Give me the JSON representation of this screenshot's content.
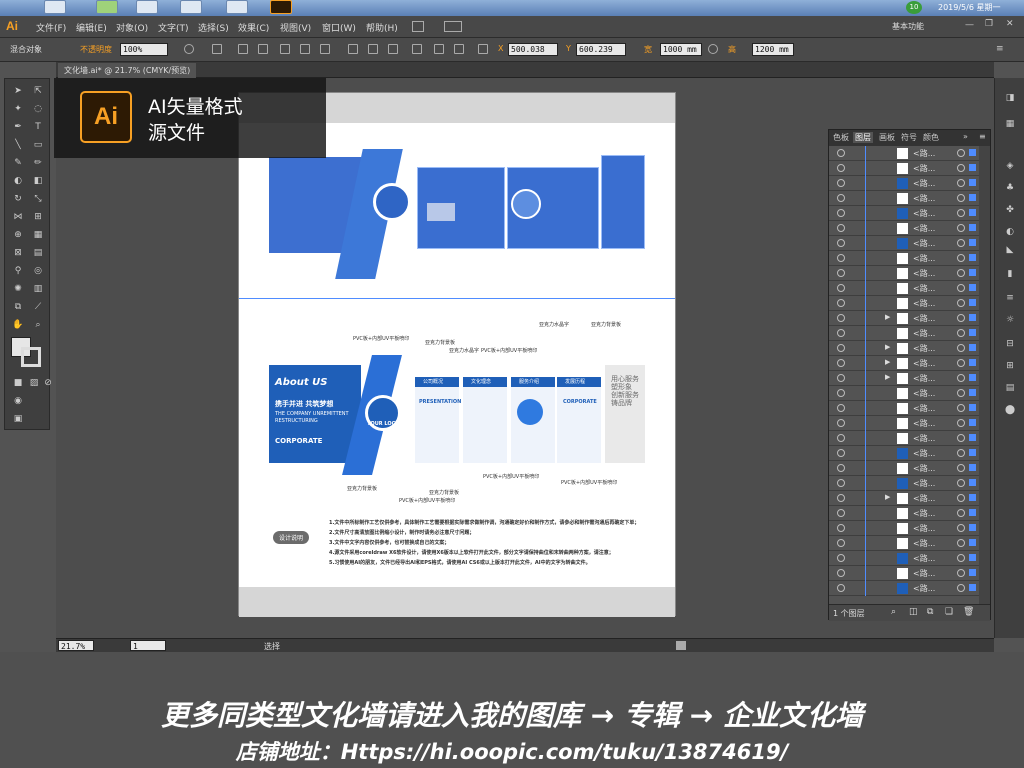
{
  "taskbar": {
    "datetime": "2019/5/6 星期一",
    "badge_count": "10"
  },
  "menubar": {
    "app_logo": "Ai",
    "items": [
      "文件(F)",
      "编辑(E)",
      "对象(O)",
      "文字(T)",
      "选择(S)",
      "效果(C)",
      "视图(V)",
      "窗口(W)",
      "帮助(H)"
    ],
    "workspace": "基本功能"
  },
  "controlbar": {
    "selection": "混合对象",
    "opacity_label": "不透明度",
    "opacity": "100%",
    "x_label": "X",
    "x": "500.038",
    "y_label": "Y",
    "y": "600.239",
    "w_label": "宽",
    "w": "1000 mm",
    "h_label": "高",
    "h": "1200 mm"
  },
  "document": {
    "tab": "文化墙.ai* @ 21.7% (CMYK/预览)",
    "badge_line1": "AI矢量格式",
    "badge_line2": "源文件"
  },
  "layers_panel": {
    "tabs": [
      "色板",
      "图层",
      "画板",
      "符号",
      "颜色"
    ],
    "footer": "1 个图层",
    "row_label": "<路..."
  },
  "artwork": {
    "about": "About US",
    "slogan": "携手并进 共筑梦想",
    "company": "THE COMPANY UNREMITTENT",
    "restructuring": "RESTRUCTURING",
    "corporate": "CORPORATE",
    "logo": "YOUR LOGO",
    "panel_titles": [
      "公司概况",
      "文化理念",
      "服务介绍",
      "发展历程"
    ],
    "presentation": "PRESENTATION",
    "vertical": "用心服务塑形象 创新服务铸品牌",
    "design_note": "设计说明",
    "notes": [
      "1.文件中所标制作工艺仅供参考，具体制作工艺需要根据实际需求做制作调，沟通确定好价和制作方式，请参必和制作需沟通后再确定下单；",
      "2.文件尺寸高清放图比例缩小设计，制作时请务必注意尺寸问题；",
      "3.文件中文字内容仅供参考，也可替换成自己的文案；",
      "4.源文件采用coreldraw X6软件设计，请使用X6版本以上软件打开此文件，部分文字请保持曲位和末转曲两种方案，请注意；",
      "5.习惯使用AI的朋友，文件已经导出AI和EPS格式，请使用AI CS6或以上版本打开此文件，AI中的文字为转曲文件。"
    ],
    "callouts": [
      "PVC板+内部UV平板喷印",
      "亚克力背景板",
      "亚克力水晶字",
      "PVC板+内部UV平板喷印",
      "亚克力水晶字",
      "亚克力背景板",
      "亚克力背景板",
      "PVC板+内部UV平板喷印",
      "亚克力背景板",
      "PVC板+内部UV平板喷印",
      "PVC板+内部UV平板喷印"
    ]
  },
  "statusbar": {
    "zoom": "21.7%",
    "page": "1",
    "tool": "选择"
  },
  "banner": {
    "line1": "更多同类型文化墙请进入我的图库 → 专辑 → 企业文化墙",
    "line2": "店铺地址：Https://hi.ooopic.com/tuku/13874619/"
  },
  "colors": {
    "accent": "#f7a024",
    "brand_blue": "#1f5fb8",
    "select_blue": "#4f8cff"
  }
}
